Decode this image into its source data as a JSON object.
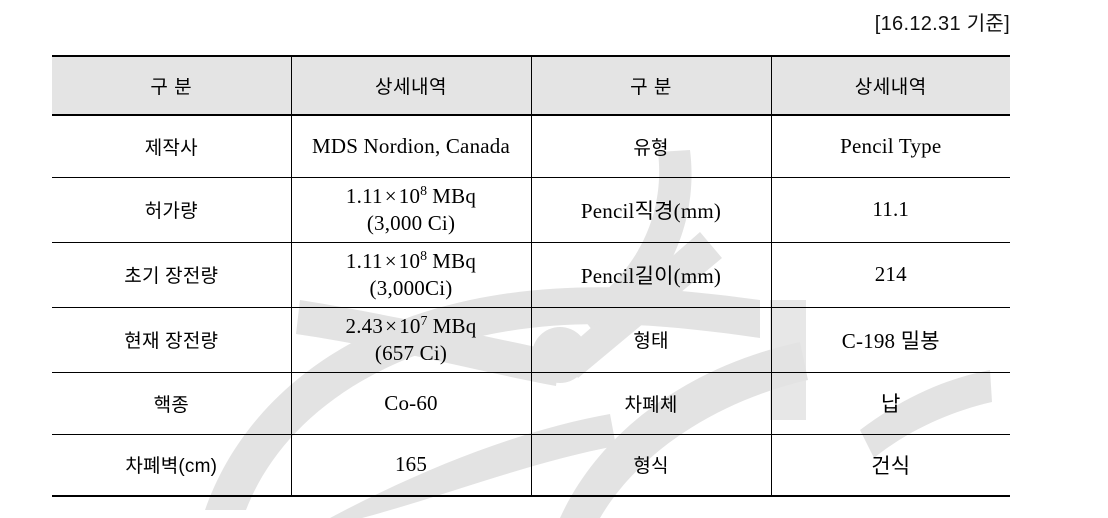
{
  "document": {
    "caption": "[16.12.31 기준]",
    "watermark_color": "#e3e3e3"
  },
  "table": {
    "header_bg": "#e4e4e4",
    "columns": [
      {
        "label": "구  분"
      },
      {
        "label": "상세내역"
      },
      {
        "label": "구  분"
      },
      {
        "label": "상세내역"
      }
    ],
    "rows": [
      {
        "left_label": "제작사",
        "left_value": "MDS Nordion,  Canada",
        "right_label": "유형",
        "right_value": "Pencil Type"
      },
      {
        "left_label": "허가량",
        "left_value_line1_mantissa": "1.11",
        "left_value_line1_times": "×",
        "left_value_line1_base": "10",
        "left_value_line1_exp": "8",
        "left_value_line1_unit": "MBq",
        "left_value_line2": "(3,000 Ci)",
        "right_label": "Pencil직경(mm)",
        "right_value": "11.1"
      },
      {
        "left_label": "초기 장전량",
        "left_value_line1_mantissa": "1.11",
        "left_value_line1_times": "×",
        "left_value_line1_base": "10",
        "left_value_line1_exp": "8",
        "left_value_line1_unit": "MBq",
        "left_value_line2": "(3,000Ci)",
        "right_label": "Pencil길이(mm)",
        "right_value": "214"
      },
      {
        "left_label": "현재 장전량",
        "left_value_line1_mantissa": "2.43",
        "left_value_line1_times": "×",
        "left_value_line1_base": "10",
        "left_value_line1_exp": "7",
        "left_value_line1_unit": "MBq",
        "left_value_line2": "(657 Ci)",
        "right_label": "형태",
        "right_value": "C-198 밀봉"
      },
      {
        "left_label": "핵종",
        "left_value": "Co-60",
        "right_label": "차폐체",
        "right_value": "납"
      },
      {
        "left_label": "차폐벽(cm)",
        "left_value": "165",
        "right_label": "형식",
        "right_value": "건식"
      }
    ]
  }
}
